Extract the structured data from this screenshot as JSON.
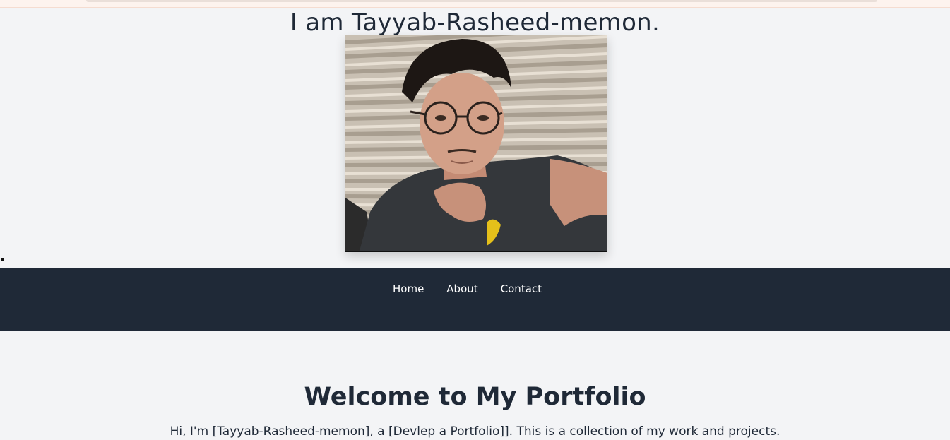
{
  "hero": {
    "title": "I am Tayyab-Rasheed-memon.",
    "photo_alt": "Tayyab-Rasheed-memon portrait"
  },
  "nav": {
    "items": [
      {
        "label": "Home"
      },
      {
        "label": "About"
      },
      {
        "label": "Contact"
      }
    ]
  },
  "main": {
    "heading": "Welcome to My Portfolio",
    "intro": "Hi, I'm [Tayyab-Rasheed-memon], a [Devlep a Portfolio]]. This is a collection of my work and projects."
  },
  "colors": {
    "page_bg": "#f3f4f6",
    "nav_bg": "#1f2937",
    "nav_text": "#ffffff",
    "heading_text": "#1f2937"
  }
}
